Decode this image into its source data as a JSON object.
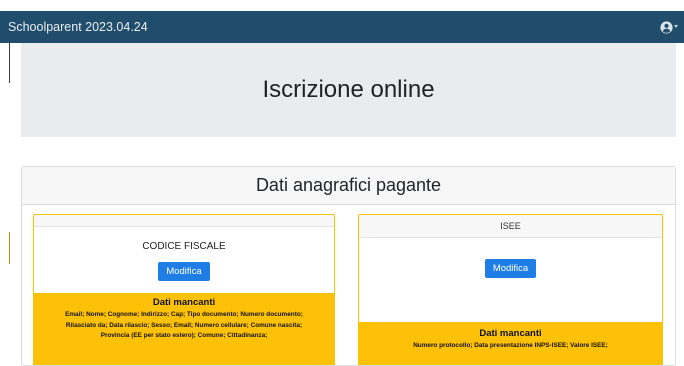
{
  "app": {
    "title": "Schoolparent 2023.04.24"
  },
  "page": {
    "heading": "Iscrizione online"
  },
  "section": {
    "title": "Dati anagrafici pagante",
    "cards": [
      {
        "header": "",
        "label": "CODICE FISCALE",
        "button_label": "Modifica",
        "missing_title": "Dati mancanti",
        "missing_fields": "Email; Nome; Cognome; Indirizzo; Cap; Tipo documento; Numero documento; Rilasciato da; Data rilascio; Sesso; Email; Numero cellulare; Comune nascita; Provincia (EE per stato estero); Comune; Cittadinanza;"
      },
      {
        "header": "ISEE",
        "button_label": "Modifica",
        "missing_title": "Dati mancanti",
        "missing_fields": "Numero protocollo; Data presentazione INPS-ISEE; Valore ISEE;"
      }
    ]
  },
  "icons": {
    "user_menu": "user-circle-icon",
    "user_menu_caret": "caret-down-icon"
  },
  "colors": {
    "navbar": "#204d6b",
    "jumbotron": "#e9ecef",
    "button": "#1e7ee6",
    "warning": "#fdc107",
    "card_border": "#f2c500"
  }
}
